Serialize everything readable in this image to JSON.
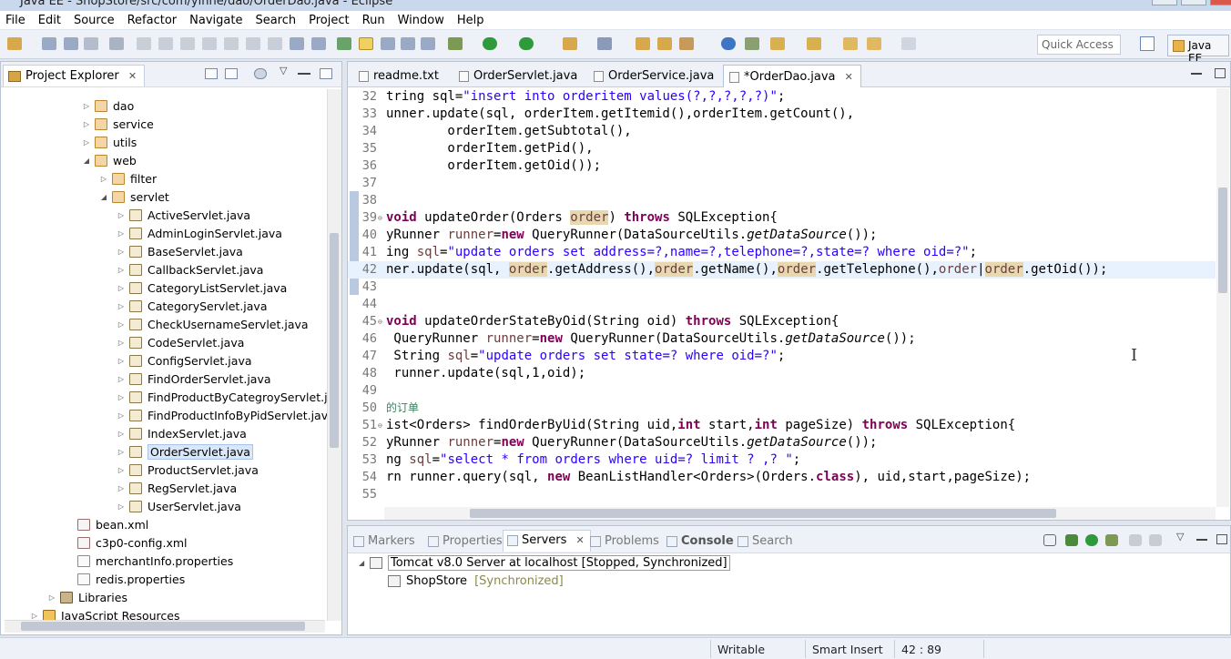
{
  "window": {
    "title": "Java EE - ShopStore/src/com/yinne/dao/OrderDao.java - Eclipse"
  },
  "menu": [
    "File",
    "Edit",
    "Source",
    "Refactor",
    "Navigate",
    "Search",
    "Project",
    "Run",
    "Window",
    "Help"
  ],
  "toolbar": {
    "quick_access_placeholder": "Quick Access",
    "perspective": "Java EE"
  },
  "explorer": {
    "title": "Project Explorer",
    "items": [
      {
        "label": "dao",
        "type": "package",
        "depth": 3,
        "arrow": "▷"
      },
      {
        "label": "service",
        "type": "package",
        "depth": 3,
        "arrow": "▷"
      },
      {
        "label": "utils",
        "type": "package",
        "depth": 3,
        "arrow": "▷"
      },
      {
        "label": "web",
        "type": "package",
        "depth": 3,
        "arrow": "◢"
      },
      {
        "label": "filter",
        "type": "package",
        "depth": 4,
        "arrow": "▷"
      },
      {
        "label": "servlet",
        "type": "package",
        "depth": 4,
        "arrow": "◢"
      },
      {
        "label": "ActiveServlet.java",
        "type": "java",
        "depth": 5,
        "arrow": "▷"
      },
      {
        "label": "AdminLoginServlet.java",
        "type": "java",
        "depth": 5,
        "arrow": "▷"
      },
      {
        "label": "BaseServlet.java",
        "type": "java",
        "depth": 5,
        "arrow": "▷"
      },
      {
        "label": "CallbackServlet.java",
        "type": "java",
        "depth": 5,
        "arrow": "▷"
      },
      {
        "label": "CategoryListServlet.java",
        "type": "java",
        "depth": 5,
        "arrow": "▷"
      },
      {
        "label": "CategoryServlet.java",
        "type": "java",
        "depth": 5,
        "arrow": "▷"
      },
      {
        "label": "CheckUsernameServlet.java",
        "type": "java",
        "depth": 5,
        "arrow": "▷"
      },
      {
        "label": "CodeServlet.java",
        "type": "java",
        "depth": 5,
        "arrow": "▷"
      },
      {
        "label": "ConfigServlet.java",
        "type": "java",
        "depth": 5,
        "arrow": "▷"
      },
      {
        "label": "FindOrderServlet.java",
        "type": "java",
        "depth": 5,
        "arrow": "▷"
      },
      {
        "label": "FindProductByCategroyServlet.java",
        "type": "java",
        "depth": 5,
        "arrow": "▷"
      },
      {
        "label": "FindProductInfoByPidServlet.java",
        "type": "java",
        "depth": 5,
        "arrow": "▷"
      },
      {
        "label": "IndexServlet.java",
        "type": "java",
        "depth": 5,
        "arrow": "▷"
      },
      {
        "label": "OrderServlet.java",
        "type": "java",
        "depth": 5,
        "arrow": "▷",
        "selected": true
      },
      {
        "label": "ProductServlet.java",
        "type": "java",
        "depth": 5,
        "arrow": "▷"
      },
      {
        "label": "RegServlet.java",
        "type": "java",
        "depth": 5,
        "arrow": "▷"
      },
      {
        "label": "UserServlet.java",
        "type": "java",
        "depth": 5,
        "arrow": "▷"
      },
      {
        "label": "bean.xml",
        "type": "xml",
        "depth": 2,
        "arrow": ""
      },
      {
        "label": "c3p0-config.xml",
        "type": "xml",
        "depth": 2,
        "arrow": ""
      },
      {
        "label": "merchantInfo.properties",
        "type": "file",
        "depth": 2,
        "arrow": ""
      },
      {
        "label": "redis.properties",
        "type": "file",
        "depth": 2,
        "arrow": ""
      },
      {
        "label": "Libraries",
        "type": "lib",
        "depth": 1,
        "arrow": "▷"
      },
      {
        "label": "JavaScript Resources",
        "type": "js",
        "depth": 0,
        "arrow": "▷"
      }
    ]
  },
  "editor": {
    "tabs": [
      {
        "label": "readme.txt",
        "active": false
      },
      {
        "label": "OrderServlet.java",
        "active": false
      },
      {
        "label": "OrderService.java",
        "active": false
      },
      {
        "label": "*OrderDao.java",
        "active": true
      }
    ],
    "lines": [
      {
        "n": "32",
        "html": "tring sql=<span class=\"str\">\"insert into orderitem values(?,?,?,?,?)\"</span>;"
      },
      {
        "n": "33",
        "html": "unner.update(sql, orderItem.getItemid(),orderItem.getCount(),"
      },
      {
        "n": "34",
        "html": "        orderItem.getSubtotal(),"
      },
      {
        "n": "35",
        "html": "        orderItem.getPid(),"
      },
      {
        "n": "36",
        "html": "        orderItem.getOid());"
      },
      {
        "n": "37",
        "html": ""
      },
      {
        "n": "38",
        "html": ""
      },
      {
        "n": "39",
        "html": "<span class=\"kw\">void</span> updateOrder(Orders <span class=\"var hl\">order</span>) <span class=\"kw\">throws</span> SQLException{",
        "fold": true
      },
      {
        "n": "40",
        "html": "yRunner <span class=\"var\">runner</span>=<span class=\"kw\">new</span> QueryRunner(DataSourceUtils.<span class=\"it\">getDataSource</span>());"
      },
      {
        "n": "41",
        "html": "ing <span class=\"var\">sql</span>=<span class=\"str\">\"update orders set address=?,name=?,telephone=?,state=? where oid=?\"</span>;"
      },
      {
        "n": "42",
        "html": "ner.update(sql, <span class=\"var hl\">order</span>.getAddress(),<span class=\"var hl\">order</span>.getName(),<span class=\"var hl\">order</span>.getTelephone(),<span class=\"var\">order</span>|<span class=\"var hl\">order</span>.getOid());",
        "current": true
      },
      {
        "n": "43",
        "html": ""
      },
      {
        "n": "44",
        "html": ""
      },
      {
        "n": "45",
        "html": "<span class=\"kw\">void</span> updateOrderStateByOid(String oid) <span class=\"kw\">throws</span> SQLException{",
        "fold": true
      },
      {
        "n": "46",
        "html": " QueryRunner <span class=\"var\">runner</span>=<span class=\"kw\">new</span> QueryRunner(DataSourceUtils.<span class=\"it\">getDataSource</span>());"
      },
      {
        "n": "47",
        "html": " String <span class=\"var\">sql</span>=<span class=\"str\">\"update orders set state=? where oid=?\"</span>;"
      },
      {
        "n": "48",
        "html": " runner.update(sql,1,oid);"
      },
      {
        "n": "49",
        "html": ""
      },
      {
        "n": "50",
        "html": "<span class=\"cm\">的订单</span>"
      },
      {
        "n": "51",
        "html": "ist&lt;Orders&gt; findOrderByUid(String uid,<span class=\"kw\">int</span> start,<span class=\"kw\">int</span> pageSize) <span class=\"kw\">throws</span> SQLException{",
        "fold": true
      },
      {
        "n": "52",
        "html": "yRunner <span class=\"var\">runner</span>=<span class=\"kw\">new</span> QueryRunner(DataSourceUtils.<span class=\"it\">getDataSource</span>());"
      },
      {
        "n": "53",
        "html": "ng <span class=\"var\">sql</span>=<span class=\"str\">\"select * from orders where uid=? limit ? ,? \"</span>;"
      },
      {
        "n": "54",
        "html": "rn runner.query(sql, <span class=\"kw\">new</span> BeanListHandler&lt;Orders&gt;(Orders.<span class=\"kw\">class</span>), uid,start,pageSize);"
      },
      {
        "n": "55",
        "html": ""
      }
    ]
  },
  "bottom": {
    "tabs": [
      {
        "label": "Markers",
        "active": false
      },
      {
        "label": "Properties",
        "active": false
      },
      {
        "label": "Servers",
        "active": true
      },
      {
        "label": "Problems",
        "active": false
      },
      {
        "label": "Console",
        "active": false
      },
      {
        "label": "Search",
        "active": false
      }
    ],
    "server": {
      "name": "Tomcat v8.0 Server at localhost",
      "state": "[Stopped, Synchronized]"
    },
    "module": {
      "name": "ShopStore",
      "state": "[Synchronized]"
    }
  },
  "status": {
    "mode": "Writable",
    "insert": "Smart Insert",
    "position": "42 : 89"
  }
}
